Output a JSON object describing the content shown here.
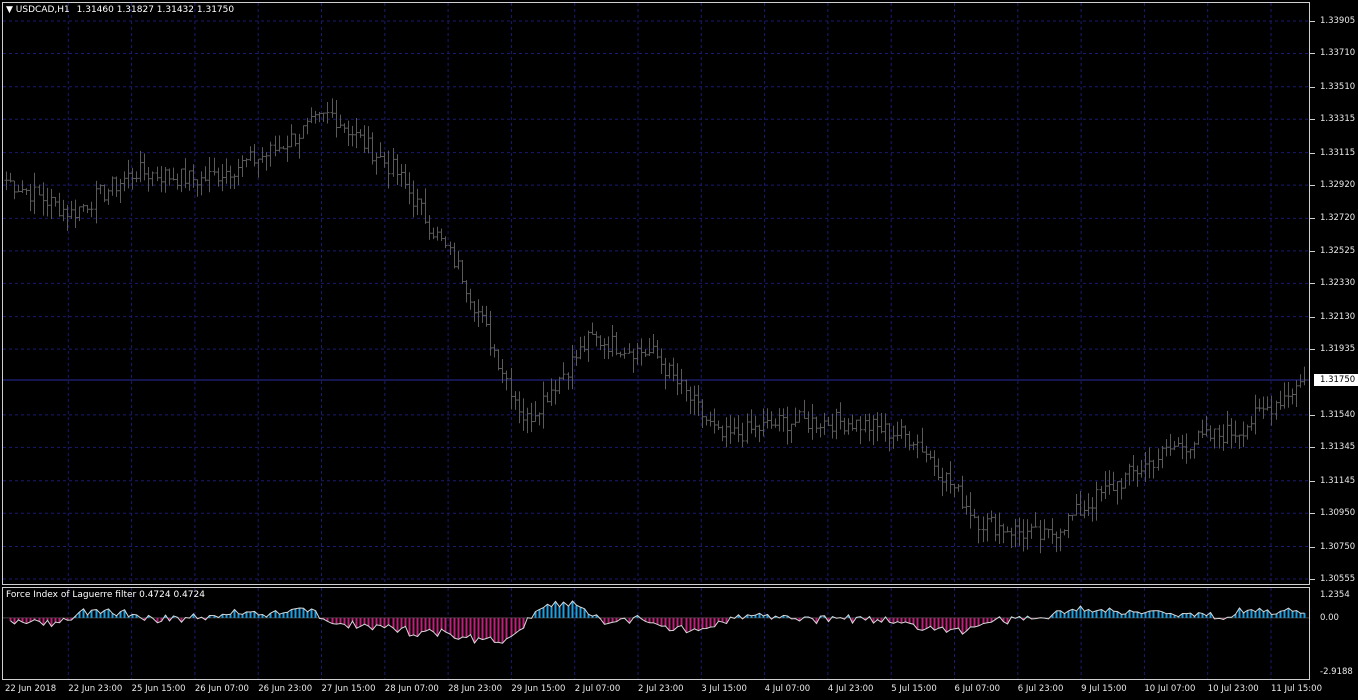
{
  "header": {
    "symbol": "USDCAD,H1",
    "ohlc": "1.31460 1.31827 1.31432 1.31750"
  },
  "indicator": {
    "title": "Force Index of Laguerre filter 0.4724 0.4724",
    "scale": [
      "1.2354",
      "0.00",
      "-2.9188"
    ]
  },
  "price_axis": [
    "1.33905",
    "1.33710",
    "1.33510",
    "1.33315",
    "1.33115",
    "1.32920",
    "1.32720",
    "1.32525",
    "1.32330",
    "1.32130",
    "1.31935",
    "1.31540",
    "1.31345",
    "1.31145",
    "1.30950",
    "1.30750",
    "1.30555"
  ],
  "current_price": "1.31750",
  "time_axis": [
    "22 Jun 2018",
    "22 Jun 23:00",
    "25 Jun 15:00",
    "26 Jun 07:00",
    "26 Jun 23:00",
    "27 Jun 15:00",
    "28 Jun 07:00",
    "28 Jun 23:00",
    "29 Jun 15:00",
    "2 Jul 07:00",
    "2 Jul 23:00",
    "3 Jul 15:00",
    "4 Jul 07:00",
    "4 Jul 23:00",
    "5 Jul 15:00",
    "6 Jul 07:00",
    "6 Jul 23:00",
    "9 Jul 15:00",
    "10 Jul 07:00",
    "10 Jul 23:00",
    "11 Jul 15:00"
  ],
  "colors": {
    "background": "#000000",
    "grid": "#1a1a6e",
    "bars": "#5a5a5a",
    "positive": "#1e9fe0",
    "negative": "#c0207a",
    "line": "#d8d8d8"
  },
  "chart_data": {
    "type": "ohlc-bar",
    "symbol": "USDCAD,H1",
    "ylim": [
      1.30555,
      1.33905
    ],
    "key_points": [
      {
        "x": "22 Jun 2018",
        "y": 1.3295
      },
      {
        "x": "22 Jun 23:00",
        "y": 1.3275
      },
      {
        "x": "25 Jun 15:00",
        "y": 1.33
      },
      {
        "x": "26 Jun 07:00",
        "y": 1.3295
      },
      {
        "x": "26 Jun 23:00",
        "y": 1.331
      },
      {
        "x": "27 Jun 15:00",
        "y": 1.3335
      },
      {
        "x": "28 Jun 07:00",
        "y": 1.33
      },
      {
        "x": "28 Jun 23:00",
        "y": 1.324
      },
      {
        "x": "29 Jun 15:00",
        "y": 1.315
      },
      {
        "x": "2 Jul 07:00",
        "y": 1.32
      },
      {
        "x": "2 Jul 23:00",
        "y": 1.319
      },
      {
        "x": "3 Jul 15:00",
        "y": 1.314
      },
      {
        "x": "4 Jul 07:00",
        "y": 1.315
      },
      {
        "x": "4 Jul 23:00",
        "y": 1.315
      },
      {
        "x": "5 Jul 15:00",
        "y": 1.314
      },
      {
        "x": "6 Jul 07:00",
        "y": 1.309
      },
      {
        "x": "6 Jul 23:00",
        "y": 1.308
      },
      {
        "x": "9 Jul 15:00",
        "y": 1.311
      },
      {
        "x": "10 Jul 07:00",
        "y": 1.3135
      },
      {
        "x": "10 Jul 23:00",
        "y": 1.3145
      },
      {
        "x": "11 Jul 15:00",
        "y": 1.3175
      }
    ],
    "indicator_range": [
      -2.9188,
      1.2354
    ]
  }
}
